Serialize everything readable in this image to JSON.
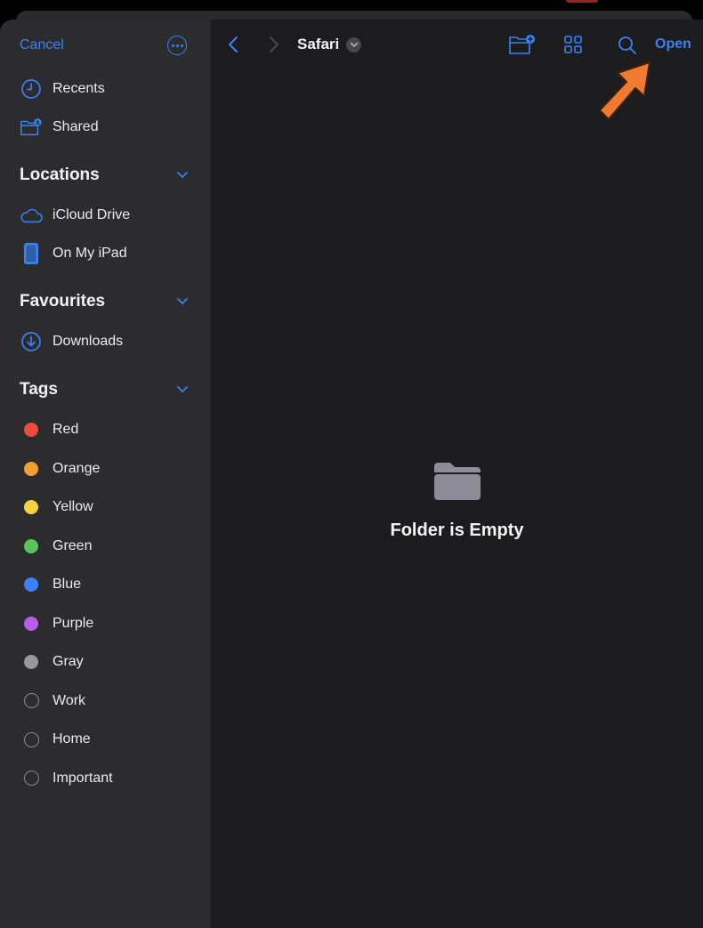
{
  "sidebar": {
    "cancel_label": "Cancel",
    "more_icon": "ellipsis-circle-icon",
    "top_items": [
      {
        "label": "Recents",
        "icon": "clock-icon"
      },
      {
        "label": "Shared",
        "icon": "shared-folder-icon"
      }
    ],
    "sections": [
      {
        "title": "Locations",
        "items": [
          {
            "label": "iCloud Drive",
            "icon": "cloud-icon"
          },
          {
            "label": "On My iPad",
            "icon": "ipad-icon"
          }
        ]
      },
      {
        "title": "Favourites",
        "items": [
          {
            "label": "Downloads",
            "icon": "download-circle-icon"
          }
        ]
      },
      {
        "title": "Tags",
        "items": [
          {
            "label": "Red",
            "color": "#eb4d3d"
          },
          {
            "label": "Orange",
            "color": "#f0a030"
          },
          {
            "label": "Yellow",
            "color": "#f5d33f"
          },
          {
            "label": "Green",
            "color": "#5ac35a"
          },
          {
            "label": "Blue",
            "color": "#3a82f7"
          },
          {
            "label": "Purple",
            "color": "#b65ee8"
          },
          {
            "label": "Gray",
            "color": "#98989d"
          },
          {
            "label": "Work",
            "color": null
          },
          {
            "label": "Home",
            "color": null
          },
          {
            "label": "Important",
            "color": null
          }
        ]
      }
    ]
  },
  "toolbar": {
    "folder_name": "Safari",
    "open_label": "Open"
  },
  "main": {
    "empty_message": "Folder is Empty"
  },
  "colors": {
    "accent": "#3a82f7",
    "annotation_arrow": "#f07a2e"
  }
}
